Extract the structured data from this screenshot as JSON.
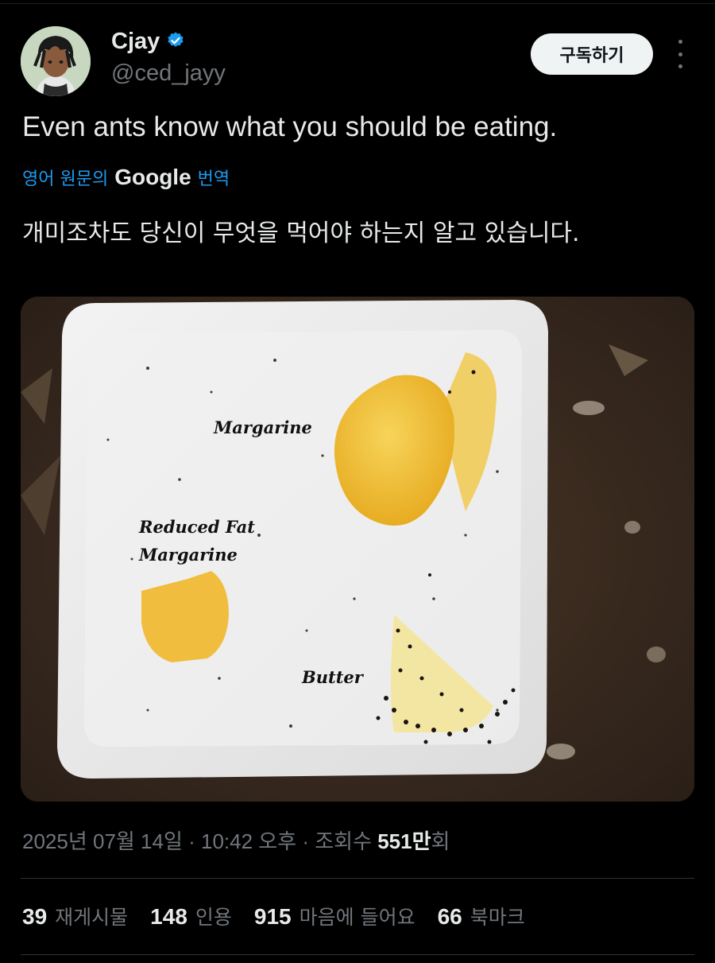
{
  "author": {
    "display_name": "Cjay",
    "handle": "@ced_jayy",
    "verified": true,
    "verified_color": "#1d9bf0"
  },
  "actions": {
    "subscribe_label": "구독하기",
    "more_icon": "more-vertical-icon"
  },
  "tweet": {
    "text": "Even ants know what you should be eating.",
    "translate_prefix": "영어 원문의",
    "translate_brand": "Google",
    "translate_suffix": "번역",
    "translated_text": "개미조차도 당신이 무엇을 먹어야 하는지 알고 있습니다."
  },
  "photo": {
    "labels": {
      "margarine": "Margarine",
      "reduced_line1": "Reduced Fat",
      "reduced_line2": "Margarine",
      "butter": "Butter"
    }
  },
  "meta": {
    "timestamp": "2025년 07월 14일 · 10:42 오후 · 조회수 ",
    "views_number": "551만",
    "views_suffix": "회"
  },
  "stats": {
    "reposts_count": "39",
    "reposts_label": "재게시물",
    "quotes_count": "148",
    "quotes_label": "인용",
    "likes_count": "915",
    "likes_label": "마음에 들어요",
    "bookmarks_count": "66",
    "bookmarks_label": "북마크"
  }
}
